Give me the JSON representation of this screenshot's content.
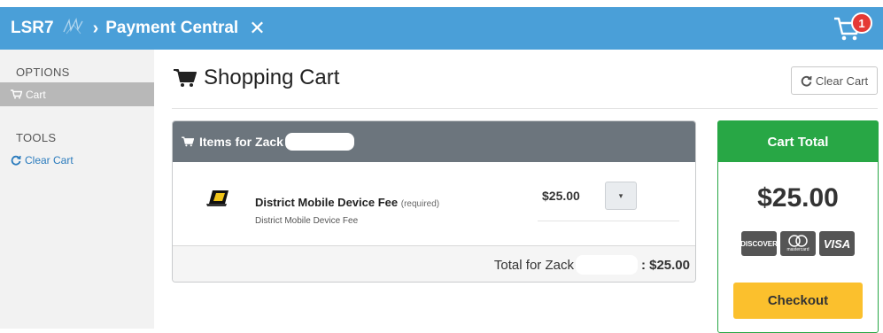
{
  "header": {
    "brand": "LSR7",
    "title": "Payment Central",
    "close_glyph": "✕",
    "separator_glyph": "›",
    "cart_count": "1",
    "color": "#4a9fd8"
  },
  "sidebar": {
    "sections": [
      {
        "heading": "OPTIONS",
        "items": [
          {
            "label": "Cart",
            "icon": "cart-icon",
            "active": true
          }
        ]
      },
      {
        "heading": "TOOLS",
        "items": [
          {
            "label": "Clear Cart",
            "icon": "refresh-icon",
            "active": false
          }
        ]
      }
    ]
  },
  "main": {
    "title": "Shopping Cart",
    "clear_button": "Clear Cart"
  },
  "items_card": {
    "heading": "Items for Zack",
    "items": [
      {
        "name": "District Mobile Device Fee",
        "required": "(required)",
        "description": "District Mobile Device Fee",
        "price": "$25.00",
        "select_glyph": "▾"
      }
    ],
    "footer_label": "Total for Zack",
    "footer_amount": ": $25.00"
  },
  "cart_total": {
    "heading": "Cart Total",
    "amount": "$25.00",
    "payment_methods": [
      "DISCOVER",
      "mastercard",
      "VISA"
    ],
    "checkout_button": "Checkout",
    "accent_color": "#28a745",
    "button_color": "#fbc02d"
  }
}
